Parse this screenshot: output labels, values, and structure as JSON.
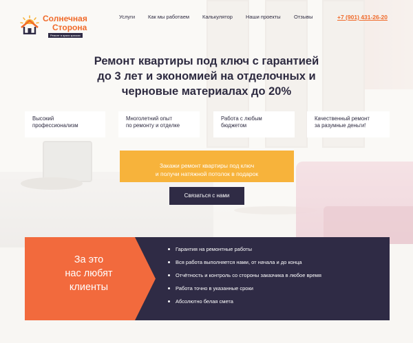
{
  "logo": {
    "line1": "Солнечная",
    "line2": "Сторона",
    "tagline": "Ремонт в ярких красках"
  },
  "nav": {
    "items": [
      "Услуги",
      "Как мы работаем",
      "Калькулятор",
      "Наши проекты",
      "Отзывы"
    ]
  },
  "phone": "+7 (901) 431-26-20",
  "hero": {
    "headline_line1": "Ремонт квартиры под ключ с гарантией",
    "headline_line2": "до 3 лет и экономией на отделочных и",
    "headline_line3": "черновые материалах до 20%"
  },
  "features": [
    {
      "line1": "Высокий",
      "line2": "профессионализм"
    },
    {
      "line1": "Многолетний опыт",
      "line2": "по ремонту и отделке"
    },
    {
      "line1": "Работа с любым",
      "line2": "бюджетом"
    },
    {
      "line1": "Качественный ремонт",
      "line2": "за разумные деньги!"
    }
  ],
  "cta": {
    "orange_line1": "Закажи ремонт квартиры под ключ",
    "orange_line2": "и получи натяжной потолок в подарок",
    "contact_label": "Связаться с нами"
  },
  "love": {
    "line1": "За это",
    "line2": "нас любят",
    "line3": "клиенты"
  },
  "reasons": [
    "Гарантия на ремонтные работы",
    "Вся работа выполняется нами, от начала и до конца",
    "Отчётность и контроль со стороны заказчика в любое время",
    "Работа точно в указанные сроки",
    "Абсолютно белая смета"
  ],
  "colors": {
    "accent_orange": "#f06a2a",
    "cta_yellow": "#f7b33b",
    "dark_navy": "#2f2b45",
    "block_orange": "#f26a3d"
  }
}
